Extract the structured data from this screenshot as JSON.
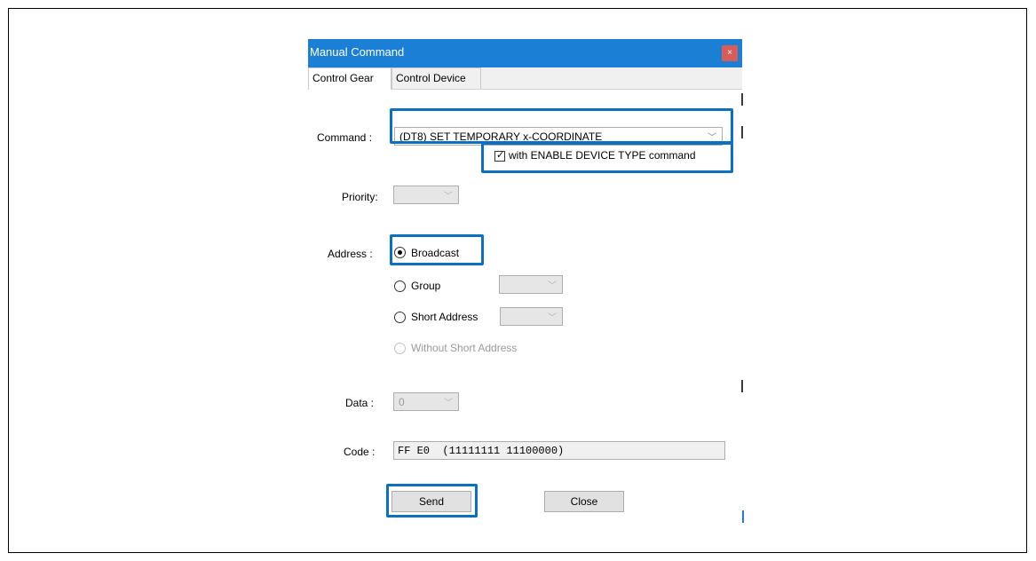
{
  "dialog": {
    "title": "Manual Command",
    "close_label": "×"
  },
  "tabs": [
    {
      "label": "Control Gear",
      "active": true
    },
    {
      "label": "Control Device",
      "active": false
    }
  ],
  "command": {
    "label": "Command :",
    "value": "(DT8) SET TEMPORARY x-COORDINATE",
    "enable_device_type_label": "with ENABLE DEVICE TYPE command",
    "enable_device_type_checked": true
  },
  "priority": {
    "label": "Priority:",
    "value": ""
  },
  "address": {
    "label": "Address :",
    "options": [
      {
        "label": "Broadcast",
        "checked": true,
        "enabled": true
      },
      {
        "label": "Group",
        "checked": false,
        "enabled": true
      },
      {
        "label": "Short Address",
        "checked": false,
        "enabled": true
      },
      {
        "label": "Without Short Address",
        "checked": false,
        "enabled": false
      }
    ],
    "group_value": "",
    "short_address_value": ""
  },
  "data": {
    "label": "Data :",
    "value": "0"
  },
  "code": {
    "label": "Code :",
    "value": "FF E0  (11111111 11100000)"
  },
  "buttons": {
    "send": "Send",
    "close": "Close"
  },
  "colors": {
    "titlebar": "#1b7fd6",
    "close_button": "#d85d59",
    "highlight": "#0c70c0"
  },
  "icons": {
    "dropdown_arrow": "chevron-down-icon",
    "check": "checkmark-icon",
    "close": "close-icon"
  }
}
